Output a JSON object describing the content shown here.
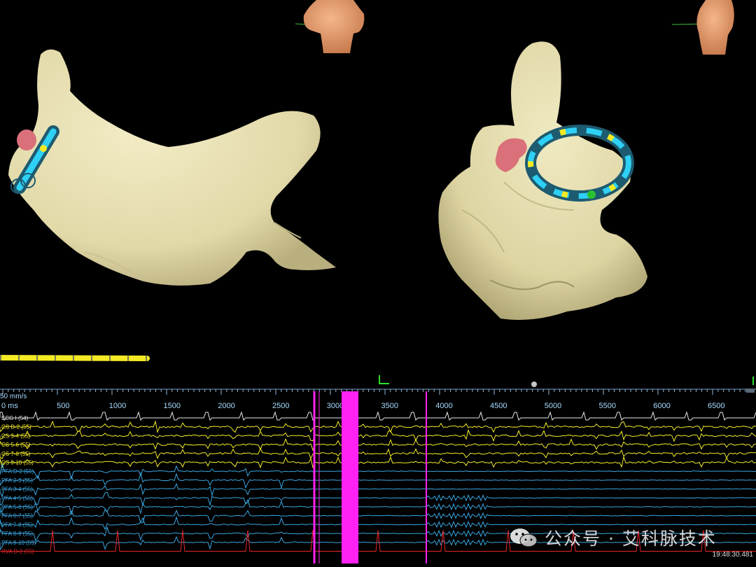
{
  "recording": {
    "sweep_label": "50 mm/s",
    "time_unit_label": "0 ms",
    "time_ticks": [
      "500",
      "1000",
      "1500",
      "2000",
      "2500",
      "3000",
      "3500",
      "4000",
      "4500",
      "5000",
      "5500",
      "6000",
      "6500"
    ],
    "clock": "19:48:30.481"
  },
  "channels": [
    {
      "label": "ECG I (54)",
      "color": "#e8e8e8"
    },
    {
      "label": "CS  D-2 (55)",
      "color": "#f2ec2a"
    },
    {
      "label": "CS  3-4 (55)",
      "color": "#f2ec2a"
    },
    {
      "label": "CS  5-6 (55)",
      "color": "#f2ec2a"
    },
    {
      "label": "CS  7-8 (55)",
      "color": "#f2ec2a"
    },
    {
      "label": "CS  9-10 (55)",
      "color": "#f2ec2a"
    },
    {
      "label": "PFA  D-2 (55)",
      "color": "#3aa6e0"
    },
    {
      "label": "PFA  2-3 (55)",
      "color": "#3aa6e0"
    },
    {
      "label": "PFA  3-4 (55)",
      "color": "#3aa6e0"
    },
    {
      "label": "PFA  4-5 (55)",
      "color": "#3aa6e0"
    },
    {
      "label": "PFA  5-6 (55)",
      "color": "#3aa6e0"
    },
    {
      "label": "PFA  6-7 (55)",
      "color": "#3aa6e0"
    },
    {
      "label": "PFA  7-8 (55)",
      "color": "#3aa6e0"
    },
    {
      "label": "PFA  8-9 (55)",
      "color": "#3aa6e0"
    },
    {
      "label": "PFA  9-10 (55)",
      "color": "#3aa6e0"
    },
    {
      "label": "RVA  D-2 (55)",
      "color": "#e8262a"
    }
  ],
  "colors": {
    "anatomy": "#e6dfb1",
    "pulse_marker": "#ff22f2",
    "catheter_blue": "#2fd0f5",
    "catheter_yellow": "#f4ea24",
    "appendage": "#d9707a"
  },
  "watermark": {
    "icon": "wechat-icon",
    "text": "公众号 · 艾科脉技术"
  }
}
